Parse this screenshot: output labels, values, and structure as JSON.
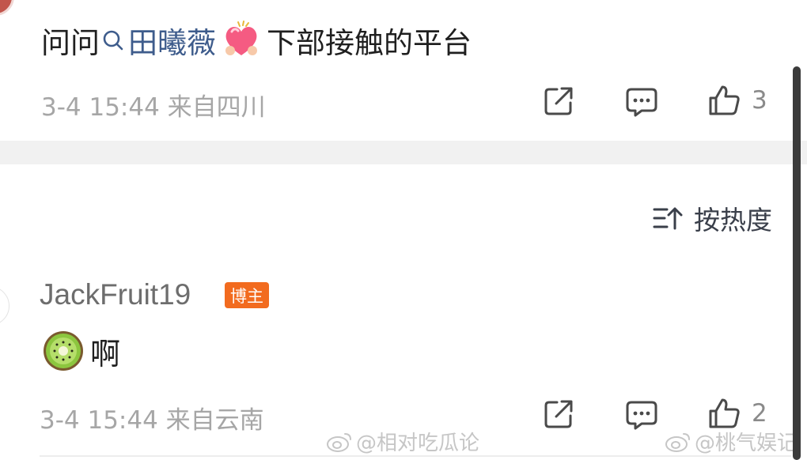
{
  "top_comment": {
    "text_before": "问问",
    "mention": "田曦薇",
    "text_after": "下部接触的平台",
    "meta": "3-4 15:44  来自四川",
    "like_count": "3"
  },
  "sort": {
    "label": "按热度"
  },
  "reply": {
    "username": "JackFruit19",
    "badge": "博主",
    "text": "啊",
    "meta": "3-4 15:44  来自云南",
    "like_count": "2"
  },
  "watermarks": [
    "@相对吃瓜论",
    "@桃气娱记"
  ],
  "colors": {
    "mention": "#3e5c8c",
    "badge": "#f26b1f",
    "meta": "#a6a6a6"
  },
  "icons": [
    "share-icon",
    "comment-icon",
    "thumbs-up-icon",
    "search-icon",
    "sort-icon",
    "heart-emoji",
    "kiwi-emoji",
    "weibo-icon"
  ]
}
